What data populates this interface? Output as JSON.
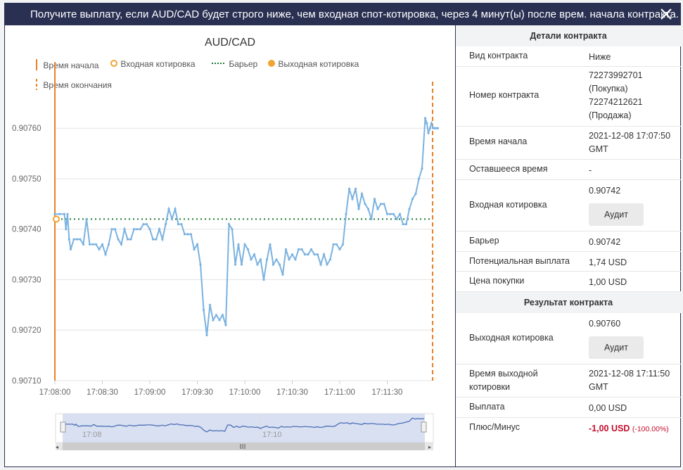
{
  "dialog": {
    "title": "Получите выплату, если AUD/CAD будет строго ниже, чем входная спот-котировка, через 4 минут(ы) после врем. начала контракта."
  },
  "chart": {
    "title": "AUD/CAD",
    "legend": {
      "start_time": "Время начала",
      "entry_spot": "Входная котировка",
      "barrier": "Барьер",
      "exit_spot": "Выходная котировка",
      "end_time": "Время окончания"
    },
    "navigator_labels": [
      "17:08",
      "17:10"
    ],
    "colors": {
      "line": "#7bb2e0",
      "start": "#e98024",
      "barrier": "#1a7a35",
      "entry": "#f0a431"
    }
  },
  "chart_data": {
    "type": "line",
    "title": "AUD/CAD",
    "xlabel": "",
    "ylabel": "",
    "x_tick_labels": [
      "17:08:00",
      "17:08:30",
      "17:09:00",
      "17:09:30",
      "17:10:00",
      "17:10:30",
      "17:11:00",
      "17:11:30"
    ],
    "y_tick_labels": [
      "0.90710",
      "0.90720",
      "0.90730",
      "0.90740",
      "0.90750",
      "0.90760"
    ],
    "ylim": [
      0.9071,
      0.90767
    ],
    "x_range_seconds_after_1708": [
      0,
      242
    ],
    "start_time": "17:07:50",
    "end_time": "17:11:50",
    "entry_spot": 0.90742,
    "barrier": 0.90742,
    "exit_spot": 0.9076,
    "series": [
      {
        "x": [
          0,
          3,
          6,
          7,
          8,
          9,
          10,
          12,
          14,
          16,
          18,
          20,
          22,
          24,
          26,
          28,
          30,
          32,
          34,
          36,
          38,
          40,
          42,
          44,
          46,
          48,
          50,
          52,
          54,
          56,
          58,
          60,
          62,
          64,
          66,
          68,
          70,
          72,
          74,
          76,
          78,
          80,
          82,
          84,
          86,
          88,
          90,
          92,
          94,
          96,
          98,
          100,
          102,
          104,
          106,
          108,
          110,
          112,
          114,
          116,
          118,
          120,
          122,
          124,
          126,
          128,
          130,
          132,
          134,
          136,
          138,
          140,
          142,
          144,
          146,
          148,
          150,
          152,
          154,
          156,
          158,
          160,
          162,
          164,
          166,
          168,
          170,
          172,
          174,
          176,
          178,
          180,
          182,
          184,
          186,
          188,
          190,
          192,
          194,
          196,
          198,
          200,
          202,
          204,
          206,
          208,
          210,
          212,
          214,
          216,
          218,
          220,
          222,
          224,
          226,
          228,
          230,
          232,
          234,
          235,
          236,
          237,
          238,
          239,
          240,
          241,
          242
        ],
        "values": [
          0.90743,
          0.90743,
          0.90743,
          0.9074,
          0.90743,
          0.90738,
          0.90736,
          0.90738,
          0.90738,
          0.90738,
          0.90737,
          0.90742,
          0.90737,
          0.90737,
          0.90737,
          0.90736,
          0.90737,
          0.90735,
          0.90737,
          0.9074,
          0.9074,
          0.90738,
          0.90737,
          0.9074,
          0.90738,
          0.90738,
          0.9074,
          0.9074,
          0.9074,
          0.90741,
          0.90741,
          0.9074,
          0.90738,
          0.90738,
          0.9074,
          0.90738,
          0.90741,
          0.90744,
          0.90742,
          0.90744,
          0.90741,
          0.90741,
          0.90739,
          0.90739,
          0.90739,
          0.90736,
          0.90737,
          0.90733,
          0.90724,
          0.90719,
          0.90725,
          0.90722,
          0.90723,
          0.90722,
          0.90723,
          0.90721,
          0.90741,
          0.9074,
          0.90733,
          0.90737,
          0.90733,
          0.90737,
          0.90736,
          0.90734,
          0.90735,
          0.90733,
          0.90734,
          0.9073,
          0.90734,
          0.90737,
          0.90733,
          0.90734,
          0.90733,
          0.90731,
          0.90736,
          0.90734,
          0.90735,
          0.90734,
          0.90736,
          0.90736,
          0.90735,
          0.90735,
          0.90736,
          0.90735,
          0.90735,
          0.90733,
          0.90735,
          0.90733,
          0.90734,
          0.90737,
          0.90737,
          0.90736,
          0.90737,
          0.90743,
          0.90748,
          0.90746,
          0.90748,
          0.90744,
          0.90747,
          0.90745,
          0.90744,
          0.90742,
          0.90746,
          0.90744,
          0.90745,
          0.90745,
          0.90743,
          0.90743,
          0.90743,
          0.90742,
          0.90743,
          0.90741,
          0.90741,
          0.90744,
          0.90746,
          0.90747,
          0.9075,
          0.90752,
          0.90762,
          0.90761,
          0.90759,
          0.9076,
          0.90761,
          0.9076,
          0.9076,
          0.9076,
          0.9076
        ]
      }
    ]
  },
  "details": {
    "header": "Детали контракта",
    "rows": {
      "type": {
        "label": "Вид контракта",
        "value": "Ниже"
      },
      "number": {
        "label": "Номер контракта",
        "lines": [
          "72273992701",
          "(Покупка)",
          "72274212621",
          "(Продажа)"
        ]
      },
      "start": {
        "label": "Время начала",
        "lines": [
          "2021-12-08 17:07:50",
          "GMT"
        ]
      },
      "remaining": {
        "label": "Оставшееся время",
        "value": "-"
      },
      "entry": {
        "label": "Входная котировка",
        "value": "0.90742",
        "button": "Аудит"
      },
      "barrier": {
        "label": "Барьер",
        "value": "0.90742"
      },
      "payout": {
        "label": "Потенциальная выплата",
        "value": "1,74 USD"
      },
      "price": {
        "label": "Цена покупки",
        "value": "1,00 USD"
      }
    }
  },
  "result": {
    "header": "Результат контракта",
    "rows": {
      "exit": {
        "label": "Выходная котировка",
        "value": "0.90760",
        "button": "Аудит"
      },
      "exit_time": {
        "label_lines": [
          "Время выходной",
          "котировки"
        ],
        "lines": [
          "2021-12-08 17:11:50",
          "GMT"
        ]
      },
      "payout": {
        "label": "Выплата",
        "value": "0,00 USD"
      },
      "pnl": {
        "label": "Плюс/Минус",
        "value": "-1,00 USD",
        "percent": "(-100.00%)"
      }
    }
  }
}
